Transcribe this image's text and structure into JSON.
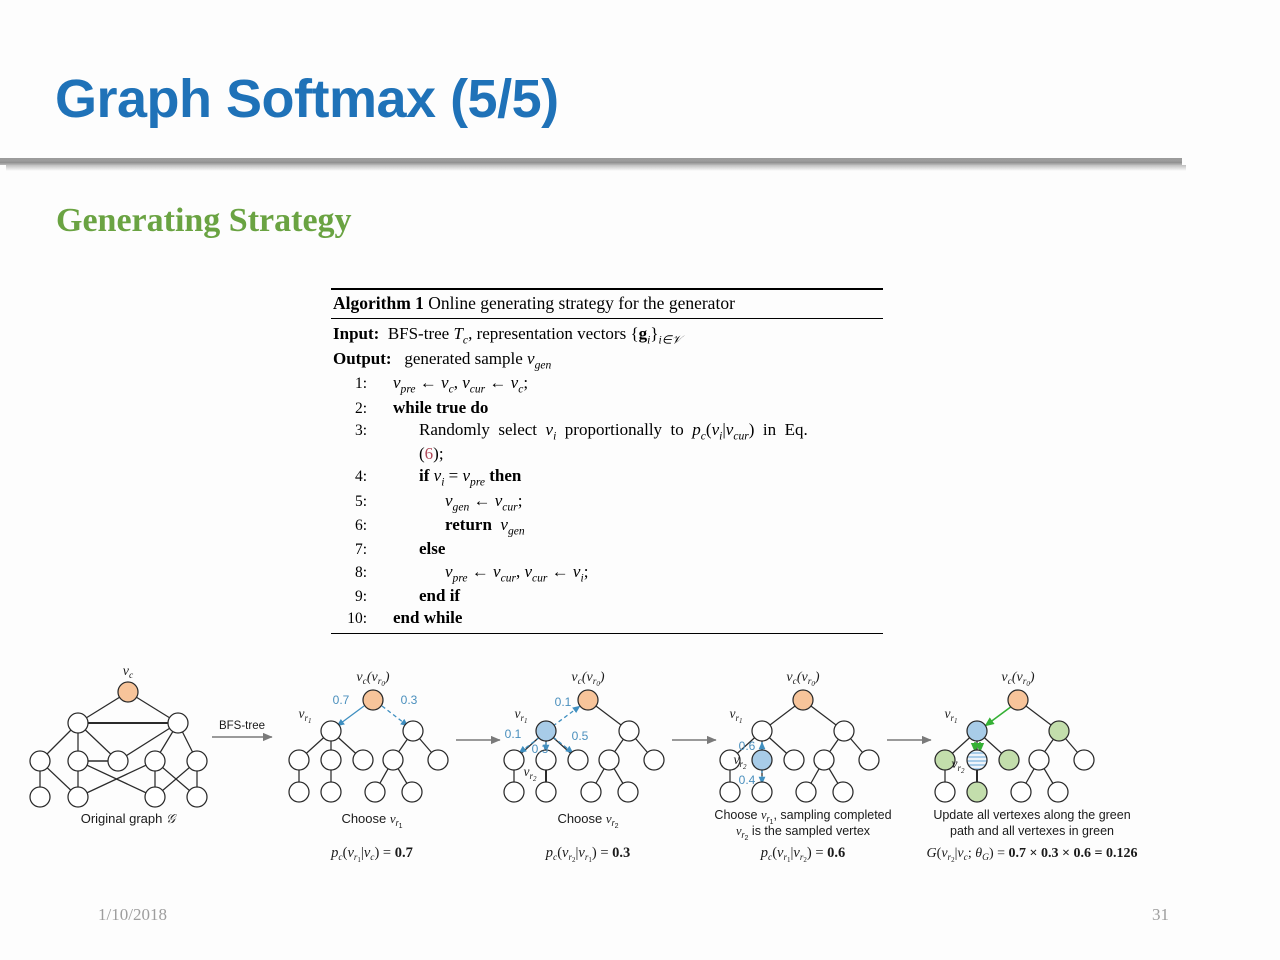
{
  "slide": {
    "title": "Graph Softmax (5/5)",
    "subtitle": "Generating Strategy",
    "title_color": "#1f72b8",
    "subtitle_color": "#6aa342",
    "footer_date": "1/10/2018",
    "footer_page": "31"
  },
  "algorithm": {
    "header_bold": "Algorithm 1",
    "header_rest": " Online generating strategy for the generator",
    "input_label": "Input:",
    "input_text": " BFS-tree Tₑ, representation vectors {gᵢ}ᵢ∈𝒱",
    "output_label": "Output:",
    "output_text": " generated sample vₘₑₙ",
    "lines": [
      {
        "num": "1:",
        "indent": 1,
        "text": "v_pre ← v_c, v_cur ← v_c;"
      },
      {
        "num": "2:",
        "indent": 1,
        "text": "while true do"
      },
      {
        "num": "3:",
        "indent": 2,
        "text": "Randomly select v_i proportionally to p_c(v_i|v_cur) in Eq."
      },
      {
        "num": "",
        "indent": 2,
        "text": "(6);"
      },
      {
        "num": "4:",
        "indent": 2,
        "text": "if v_i = v_pre then"
      },
      {
        "num": "5:",
        "indent": 3,
        "text": "v_gen ← v_cur;"
      },
      {
        "num": "6:",
        "indent": 3,
        "text": "return v_gen"
      },
      {
        "num": "7:",
        "indent": 2,
        "text": "else"
      },
      {
        "num": "8:",
        "indent": 3,
        "text": "v_pre ← v_cur, v_cur ← v_i;"
      },
      {
        "num": "9:",
        "indent": 2,
        "text": "end if"
      },
      {
        "num": "10:",
        "indent": 1,
        "text": "end while"
      }
    ]
  },
  "figure": {
    "arrow_label_bfs": "BFS-tree",
    "panels": [
      {
        "id": "original-graph",
        "caption": "Original graph 𝒢",
        "root_label": "v_c",
        "formula": ""
      },
      {
        "id": "choose-vr1",
        "root_label": "v_c(v_r0)",
        "node_label": "v_r1",
        "edge_weights": [
          "0.7",
          "0.3"
        ],
        "caption": "Choose v_r1",
        "formula": "p_c(v_r1|v_c) = 0.7"
      },
      {
        "id": "choose-vr2",
        "root_label": "v_c(v_r0)",
        "node_label_1": "v_r1",
        "node_label_2": "v_r2",
        "edge_weights": [
          "0.1",
          "0.1",
          "0.3",
          "0.5"
        ],
        "caption": "Choose v_r2",
        "formula": "p_c(v_r2|v_r1) = 0.3"
      },
      {
        "id": "sampling-completed",
        "root_label": "v_c(v_r0)",
        "node_label_1": "v_r1",
        "node_label_2": "v_r2",
        "edge_weights": [
          "0.6",
          "0.4"
        ],
        "caption_line1": "Choose v_r1, sampling completed",
        "caption_line2": "v_r2 is the sampled vertex",
        "formula": "p_c(v_r1|v_r2) = 0.6"
      },
      {
        "id": "update-green-path",
        "root_label": "v_c(v_r0)",
        "node_label_1": "v_r1",
        "node_label_2": "v_r2",
        "caption_line1": "Update all vertexes along the green",
        "caption_line2": "path and all vertexes in green",
        "formula": "G(v_r2|v_c; θ_G) = 0.7 × 0.3 × 0.6 = 0.126"
      }
    ],
    "colors": {
      "root_node": "#f7c49a",
      "selected_node": "#a8cce8",
      "green_node": "#c3deac",
      "weight_text": "#4a8fbd",
      "edge": "#2b2b2b",
      "green_edge": "#35b035",
      "blue_edge": "#3f8fc0"
    }
  }
}
